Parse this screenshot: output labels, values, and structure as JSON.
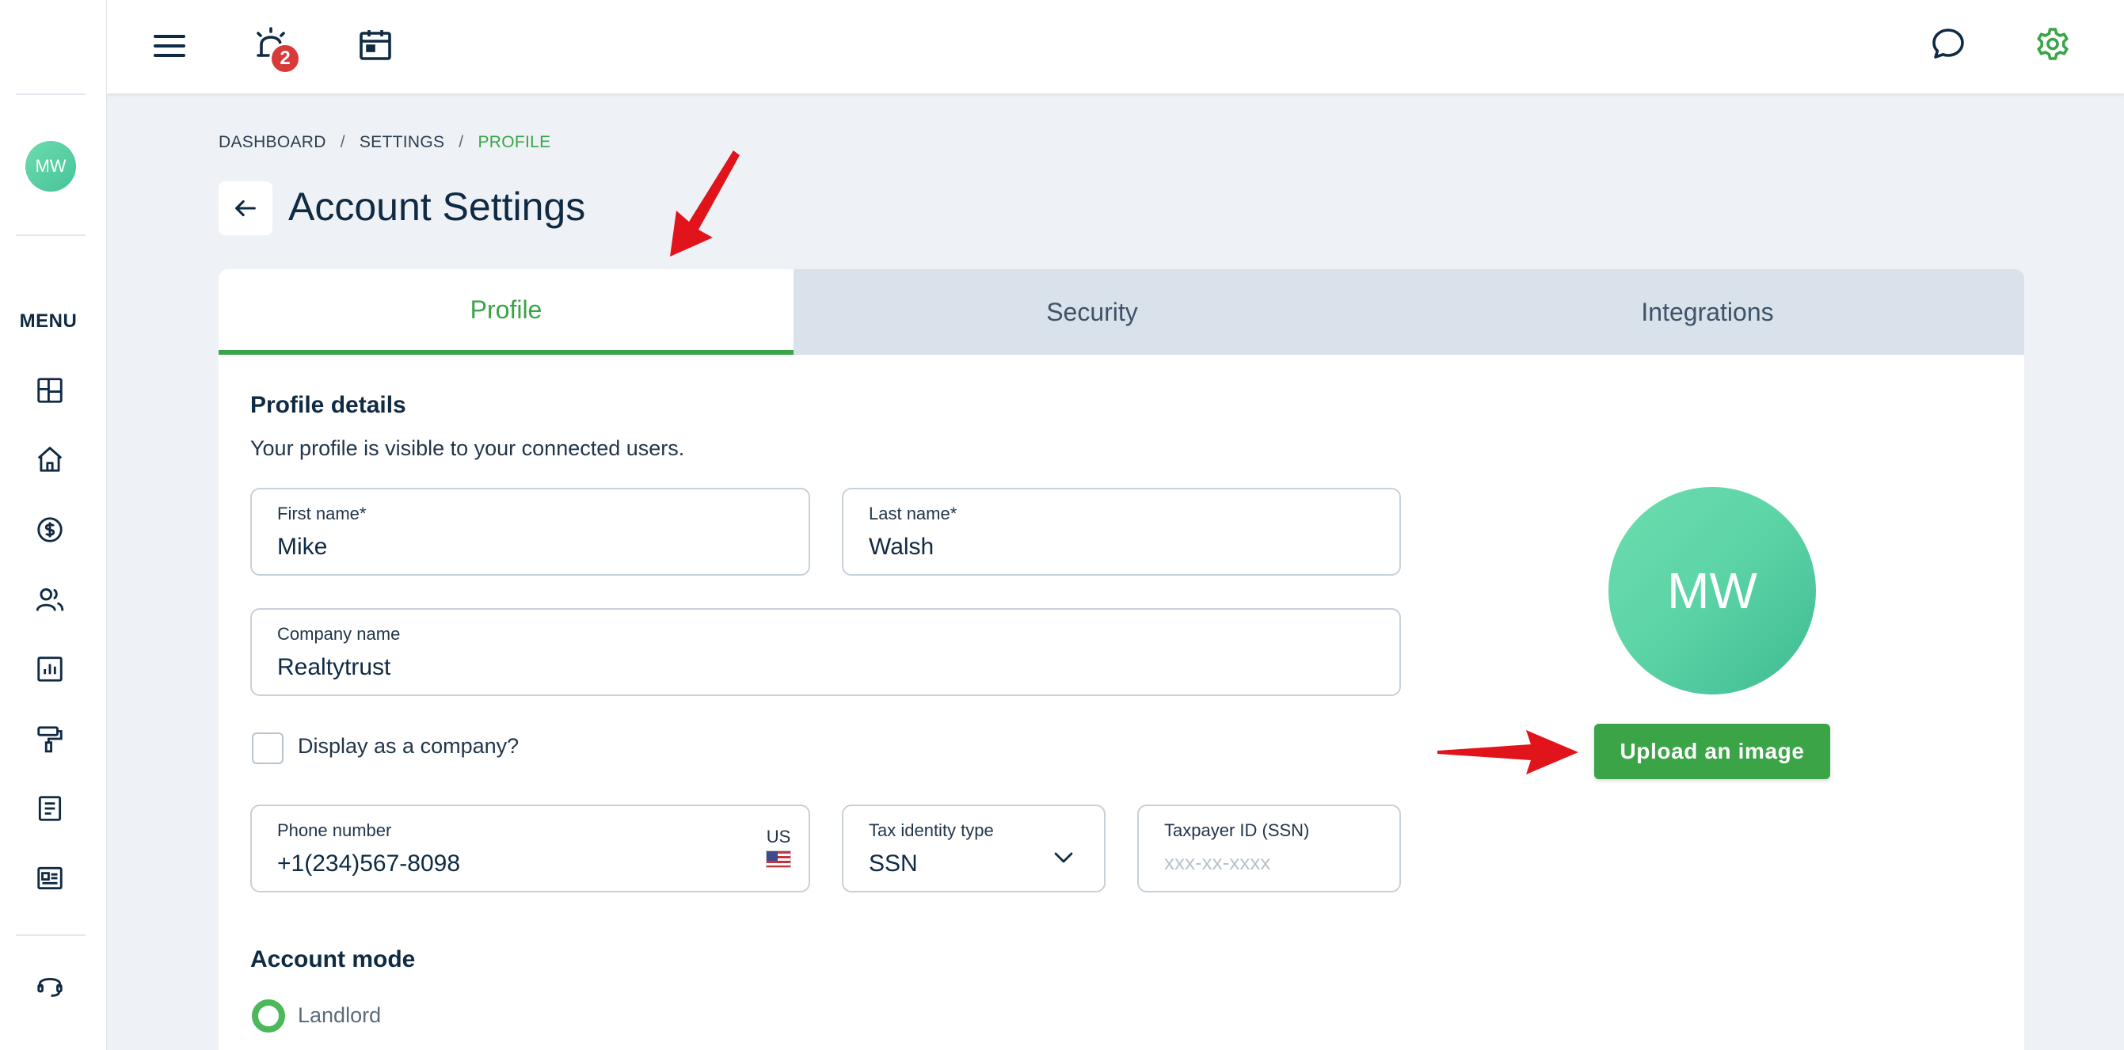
{
  "sidebar": {
    "avatar_initials": "MW",
    "menu_label": "MENU",
    "icons": [
      "dashboard-icon",
      "home-icon",
      "dollar-icon",
      "users-icon",
      "chart-icon",
      "paint-roller-icon",
      "document-icon",
      "newspaper-icon",
      "headset-icon"
    ]
  },
  "topbar": {
    "notification_count": "2",
    "icons": [
      "hamburger-menu-icon",
      "alarm-icon",
      "calendar-icon",
      "chat-icon",
      "gear-icon"
    ]
  },
  "breadcrumb": {
    "items": [
      "DASHBOARD",
      "SETTINGS",
      "PROFILE"
    ],
    "separator": "/"
  },
  "page": {
    "title": "Account Settings"
  },
  "tabs": [
    {
      "label": "Profile",
      "active": true
    },
    {
      "label": "Security",
      "active": false
    },
    {
      "label": "Integrations",
      "active": false
    }
  ],
  "profile": {
    "section_title": "Profile details",
    "section_subtitle": "Your profile is visible to your connected users.",
    "first_name": {
      "label": "First name*",
      "value": "Mike"
    },
    "last_name": {
      "label": "Last name*",
      "value": "Walsh"
    },
    "company_name": {
      "label": "Company name",
      "value": "Realtytrust"
    },
    "display_as_company": {
      "label": "Display as a company?",
      "checked": false
    },
    "phone": {
      "label": "Phone number",
      "value": "+1(234)567-8098",
      "country": "US"
    },
    "tax_identity": {
      "label": "Tax identity type",
      "value": "SSN"
    },
    "taxpayer_id": {
      "label": "Taxpayer ID (SSN)",
      "placeholder": "xxx-xx-xxxx"
    },
    "avatar_initials": "MW",
    "upload_button": "Upload an image"
  },
  "account_mode": {
    "title": "Account mode",
    "options": [
      {
        "label": "Landlord",
        "selected": true
      }
    ]
  },
  "colors": {
    "accent": "#3aa447",
    "avatar": "#5dd5a7",
    "badge": "#d83a3a",
    "annotation_arrow": "#e0141a"
  }
}
